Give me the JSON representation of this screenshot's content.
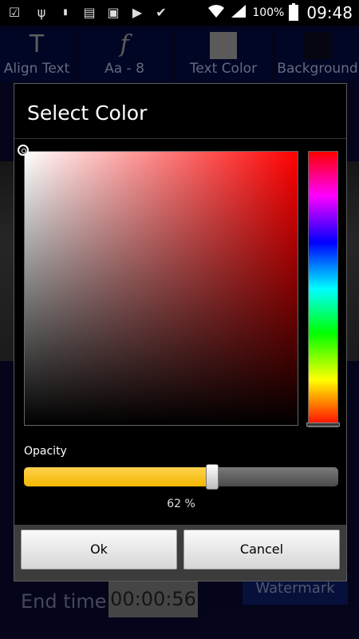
{
  "status_bar": {
    "battery_percent": "100%",
    "time": "09:48",
    "notification_icons": [
      "notification-icon",
      "usb-icon",
      "battery-100-icon",
      "news-icon",
      "save-icon",
      "media-icon",
      "task-icon"
    ]
  },
  "toolbar": {
    "align_text": "Align Text",
    "font": "Aa - 8",
    "text_color": "Text Color",
    "background": "Background"
  },
  "background": {
    "end_time_label": "End time",
    "end_time_value": "00:00:56",
    "watermark": "Watermark"
  },
  "dialog": {
    "title": "Select Color",
    "opacity_label": "Opacity",
    "opacity_value": "62 %",
    "opacity_level": 0.62,
    "selected_hue": "#ff0000",
    "ok_label": "Ok",
    "cancel_label": "Cancel"
  }
}
